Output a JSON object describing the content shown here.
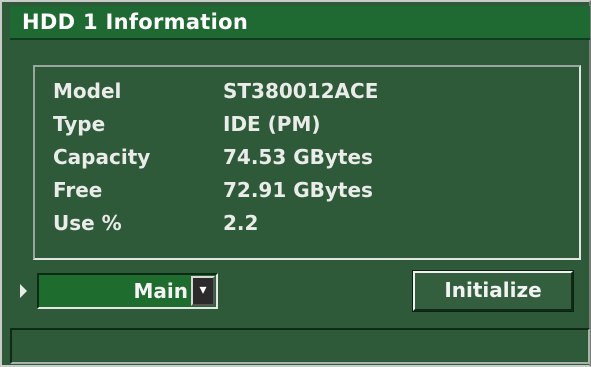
{
  "window": {
    "title": "HDD 1 Information"
  },
  "info": {
    "rows": [
      {
        "label": "Model",
        "value": "ST380012ACE"
      },
      {
        "label": "Type",
        "value": "IDE (PM)"
      },
      {
        "label": "Capacity",
        "value": "74.53 GBytes"
      },
      {
        "label": "Free",
        "value": "72.91 GBytes"
      },
      {
        "label": "Use %",
        "value": "2.2"
      }
    ]
  },
  "controls": {
    "selected_option": "Main",
    "initialize_label": "Initialize",
    "dropdown_icon": "chevron-down-icon",
    "pointer_icon": "triangle-right-icon"
  },
  "status": {
    "text": ""
  },
  "colors": {
    "window_bg": "#2f5a3a",
    "title_bg": "#1f6a33",
    "select_bg": "#1e6d2e",
    "text": "#e9ece9"
  }
}
